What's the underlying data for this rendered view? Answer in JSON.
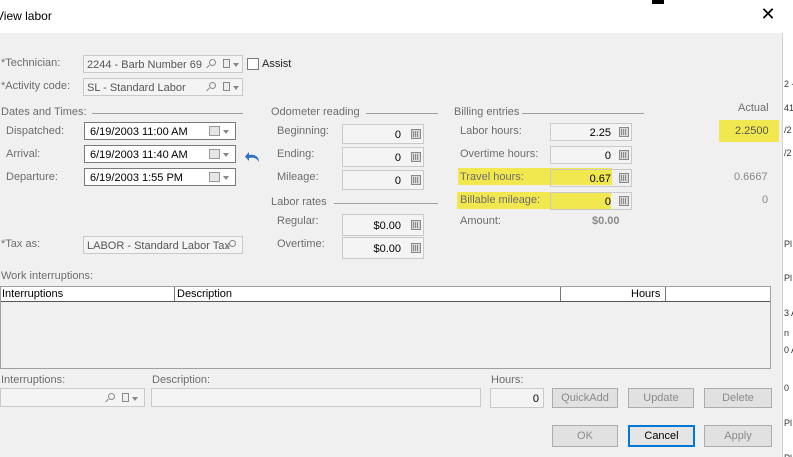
{
  "window": {
    "title": "View labor",
    "close_glyph": "✕"
  },
  "technician": {
    "label": "*Technician:",
    "value": "2244 - Barb Number 69",
    "assist_label": "Assist"
  },
  "activity": {
    "label": "*Activity code:",
    "value": "SL - Standard Labor"
  },
  "dates": {
    "section": "Dates and Times:",
    "dispatched_label": "Dispatched:",
    "dispatched": "6/19/2003 11:00 AM",
    "arrival_label": "Arrival:",
    "arrival": "6/19/2003 11:40 AM",
    "departure_label": "Departure:",
    "departure": "6/19/2003   1:55 PM"
  },
  "tax": {
    "label": "*Tax as:",
    "value": "LABOR - Standard Labor Tax"
  },
  "odometer": {
    "section": "Odometer reading",
    "beginning_label": "Beginning:",
    "beginning": "0",
    "ending_label": "Ending:",
    "ending": "0",
    "mileage_label": "Mileage:",
    "mileage": "0"
  },
  "rates": {
    "section": "Labor rates",
    "regular_label": "Regular:",
    "regular": "$0.00",
    "overtime_label": "Overtime:",
    "overtime": "$0.00"
  },
  "billing": {
    "section": "Billing entries",
    "labor_label": "Labor hours:",
    "labor": "2.25",
    "overtime_label": "Overtime hours:",
    "overtime": "0",
    "travel_label": "Travel hours:",
    "travel": "0.67",
    "mileage_label": "Billable mileage:",
    "mileage": "0",
    "amount_label": "Amount:",
    "amount": "$0.00"
  },
  "actual": {
    "header": "Actual",
    "labor": "2.2500",
    "travel": "0.6667",
    "mileage": "0"
  },
  "interruptions": {
    "section": "Work interruptions:",
    "columns": {
      "interruptions": "Interruptions",
      "description": "Description",
      "hours": "Hours"
    },
    "interruptions_label": "Interruptions:",
    "description_label": "Description:",
    "hours_label": "Hours:",
    "hours_value": "0"
  },
  "buttons": {
    "quickadd": "QuickAdd",
    "update": "Update",
    "delete": "Delete",
    "ok": "OK",
    "cancel": "Cancel",
    "apply": "Apply"
  },
  "right_strip": {
    "r1": "2 -",
    "r2": "41",
    "r3": "/2",
    "r4": "/2",
    "r5": "Pl",
    "r6": "Pl",
    "r7": "3 A",
    "r8": "n",
    "r9": "0 A",
    "r10": "0",
    "r11": "Pl",
    "r12": "Pl"
  },
  "colors": {
    "highlight": "#f1e74f",
    "accent": "#0078d7"
  }
}
